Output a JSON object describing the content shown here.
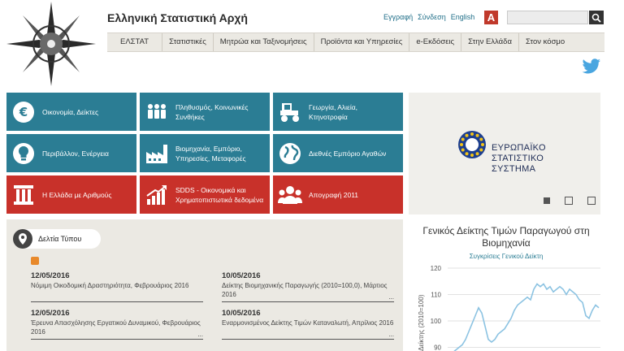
{
  "header": {
    "site_title": "Ελληνική Στατιστική Αρχή",
    "links": {
      "register": "Εγγραφή",
      "login": "Σύνδεση",
      "english": "English"
    },
    "accessibility_label": "A",
    "search_placeholder": ""
  },
  "nav": {
    "items": [
      "ΕΛΣΤΑΤ",
      "Στατιστικές",
      "Μητρώα και Ταξινομήσεις",
      "Προϊόντα και Υπηρεσίες",
      "e-Εκδόσεις",
      "Στην Ελλάδα",
      "Στον κόσμο"
    ]
  },
  "tiles": [
    {
      "label": "Οικονομία, Δείκτες",
      "icon": "euro-icon",
      "color": "#2b7d94"
    },
    {
      "label": "Πληθυσμός, Κοινωνικές Συνθήκες",
      "icon": "people-icon",
      "color": "#2b7d94"
    },
    {
      "label": "Γεωργία, Αλιεία, Κτηνοτροφία",
      "icon": "tractor-icon",
      "color": "#2b7d94"
    },
    {
      "label": "Περιβάλλον, Ενέργεια",
      "icon": "lightbulb-icon",
      "color": "#2b7d94"
    },
    {
      "label": "Βιομηχανία, Εμπόριο, Υπηρεσίες, Μεταφορές",
      "icon": "factory-icon",
      "color": "#2b7d94"
    },
    {
      "label": "Διεθνές Εμπόριο Αγαθών",
      "icon": "globe-icon",
      "color": "#2b7d94"
    },
    {
      "label": "Η Ελλάδα με Αριθμούς",
      "icon": "column-icon",
      "color": "#c8312a"
    },
    {
      "label": "SDDS - Οικονομικά και Χρηματοπιστωτικά δεδομένα",
      "icon": "chart-up-icon",
      "color": "#c8312a"
    },
    {
      "label": "Απογραφή 2011",
      "icon": "group-icon",
      "color": "#c8312a"
    }
  ],
  "banner": {
    "lines": [
      "ΕΥΡΩΠΑΪΚΟ",
      "ΣΤΑΤΙΣΤΙΚΟ",
      "ΣΥΣΤΗΜΑ"
    ]
  },
  "press": {
    "tab_label": "Δελτία Τύπου",
    "more": "...",
    "items": [
      {
        "date": "12/05/2016",
        "title": "Νόμιμη Οικοδομική Δραστηριότητα, Φεβρουάριος 2016"
      },
      {
        "date": "10/05/2016",
        "title": "Δείκτης Βιομηχανικής Παραγωγής (2010=100,0), Μάρτιος 2016"
      },
      {
        "date": "12/05/2016",
        "title": "Έρευνα Απασχόλησης Εργατικού Δυναμικού, Φεβρουάριος 2016"
      },
      {
        "date": "10/05/2016",
        "title": "Εναρμονισμένος Δείκτης Τιμών Καταναλωτή, Απρίλιος 2016"
      }
    ]
  },
  "chart_data": {
    "type": "line",
    "title": "Γενικός Δείκτης Τιμών Παραγωγού στη Βιομηχανία",
    "subtitle": "Συγκρίσεις Γενικού Δείκτη",
    "ylabel": "Δείκτης (2010=100)",
    "ylim": [
      90,
      120
    ],
    "yticks": [
      90,
      100,
      110,
      120
    ],
    "color": "#8cc3e2",
    "values": [
      87,
      88,
      89,
      90,
      91,
      93,
      96,
      99,
      102,
      105,
      103,
      98,
      93,
      92,
      93,
      95,
      96,
      97,
      99,
      101,
      104,
      106,
      107,
      108,
      109,
      108,
      112,
      114,
      113,
      114,
      112,
      113,
      111,
      112,
      113,
      112,
      110,
      112,
      111,
      110,
      108,
      107,
      102,
      101,
      104,
      106,
      105
    ]
  }
}
